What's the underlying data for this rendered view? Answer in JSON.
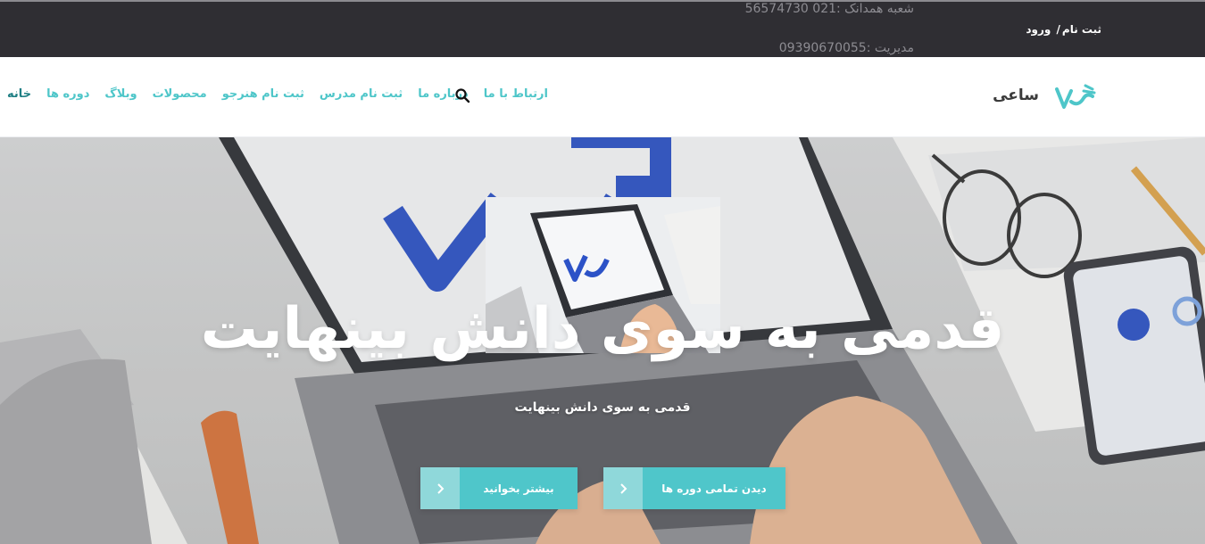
{
  "topbar": {
    "contact_branch": "شعبه همدانک :021 56574730",
    "contact_manager": "مدیریت :09390670055",
    "register": "ثبت نام",
    "separator": "/",
    "login": "ورود"
  },
  "header": {
    "brand": "ساعی",
    "logo_icon": "brand-logo",
    "nav": [
      {
        "label": "خانه",
        "active": true
      },
      {
        "label": "دوره ها"
      },
      {
        "label": "وبلاگ"
      },
      {
        "label": "محصولات"
      },
      {
        "label": "ثبت نام هنرجو"
      },
      {
        "label": "ثبت نام مدرس"
      },
      {
        "label": "درباره ما"
      },
      {
        "label": "ارتباط با ما"
      }
    ],
    "search_icon": "search-icon"
  },
  "hero": {
    "title": "قدمی به سوی دانش بینهایت",
    "subtitle": "قدمی به سوی دانش بینهایت",
    "buttons": [
      {
        "label": "دیدن تمامی دوره ها",
        "icon": "chevron-right-icon"
      },
      {
        "label": "بیشتر بخوانید",
        "icon": "chevron-right-icon"
      }
    ]
  },
  "colors": {
    "accent": "#4ec6c9",
    "accent_dark": "#1f7f84",
    "topbar": "#2f2e33",
    "logo_blue": "#2c52c7"
  }
}
